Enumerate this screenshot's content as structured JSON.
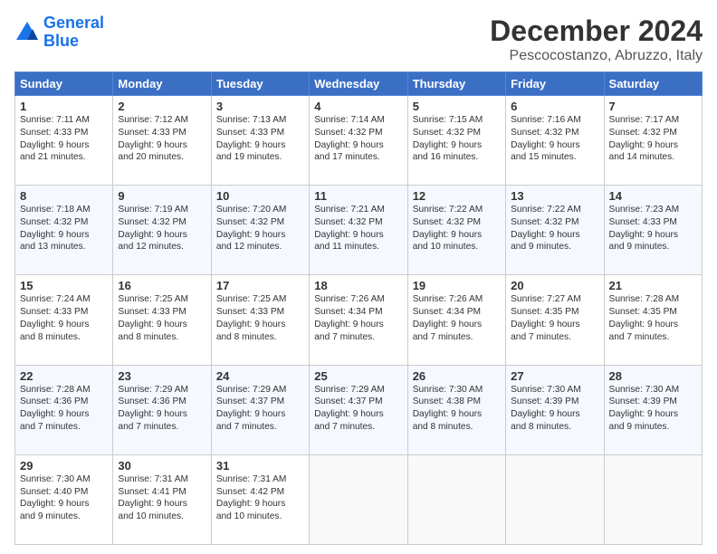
{
  "header": {
    "logo_line1": "General",
    "logo_line2": "Blue",
    "title": "December 2024",
    "subtitle": "Pescocostanzo, Abruzzo, Italy"
  },
  "columns": [
    "Sunday",
    "Monday",
    "Tuesday",
    "Wednesday",
    "Thursday",
    "Friday",
    "Saturday"
  ],
  "weeks": [
    [
      {
        "day": "1",
        "sunrise": "7:11 AM",
        "sunset": "4:33 PM",
        "daylight": "9 hours and 21 minutes."
      },
      {
        "day": "2",
        "sunrise": "7:12 AM",
        "sunset": "4:33 PM",
        "daylight": "9 hours and 20 minutes."
      },
      {
        "day": "3",
        "sunrise": "7:13 AM",
        "sunset": "4:33 PM",
        "daylight": "9 hours and 19 minutes."
      },
      {
        "day": "4",
        "sunrise": "7:14 AM",
        "sunset": "4:32 PM",
        "daylight": "9 hours and 17 minutes."
      },
      {
        "day": "5",
        "sunrise": "7:15 AM",
        "sunset": "4:32 PM",
        "daylight": "9 hours and 16 minutes."
      },
      {
        "day": "6",
        "sunrise": "7:16 AM",
        "sunset": "4:32 PM",
        "daylight": "9 hours and 15 minutes."
      },
      {
        "day": "7",
        "sunrise": "7:17 AM",
        "sunset": "4:32 PM",
        "daylight": "9 hours and 14 minutes."
      }
    ],
    [
      {
        "day": "8",
        "sunrise": "7:18 AM",
        "sunset": "4:32 PM",
        "daylight": "9 hours and 13 minutes."
      },
      {
        "day": "9",
        "sunrise": "7:19 AM",
        "sunset": "4:32 PM",
        "daylight": "9 hours and 12 minutes."
      },
      {
        "day": "10",
        "sunrise": "7:20 AM",
        "sunset": "4:32 PM",
        "daylight": "9 hours and 12 minutes."
      },
      {
        "day": "11",
        "sunrise": "7:21 AM",
        "sunset": "4:32 PM",
        "daylight": "9 hours and 11 minutes."
      },
      {
        "day": "12",
        "sunrise": "7:22 AM",
        "sunset": "4:32 PM",
        "daylight": "9 hours and 10 minutes."
      },
      {
        "day": "13",
        "sunrise": "7:22 AM",
        "sunset": "4:32 PM",
        "daylight": "9 hours and 9 minutes."
      },
      {
        "day": "14",
        "sunrise": "7:23 AM",
        "sunset": "4:33 PM",
        "daylight": "9 hours and 9 minutes."
      }
    ],
    [
      {
        "day": "15",
        "sunrise": "7:24 AM",
        "sunset": "4:33 PM",
        "daylight": "9 hours and 8 minutes."
      },
      {
        "day": "16",
        "sunrise": "7:25 AM",
        "sunset": "4:33 PM",
        "daylight": "9 hours and 8 minutes."
      },
      {
        "day": "17",
        "sunrise": "7:25 AM",
        "sunset": "4:33 PM",
        "daylight": "9 hours and 8 minutes."
      },
      {
        "day": "18",
        "sunrise": "7:26 AM",
        "sunset": "4:34 PM",
        "daylight": "9 hours and 7 minutes."
      },
      {
        "day": "19",
        "sunrise": "7:26 AM",
        "sunset": "4:34 PM",
        "daylight": "9 hours and 7 minutes."
      },
      {
        "day": "20",
        "sunrise": "7:27 AM",
        "sunset": "4:35 PM",
        "daylight": "9 hours and 7 minutes."
      },
      {
        "day": "21",
        "sunrise": "7:28 AM",
        "sunset": "4:35 PM",
        "daylight": "9 hours and 7 minutes."
      }
    ],
    [
      {
        "day": "22",
        "sunrise": "7:28 AM",
        "sunset": "4:36 PM",
        "daylight": "9 hours and 7 minutes."
      },
      {
        "day": "23",
        "sunrise": "7:29 AM",
        "sunset": "4:36 PM",
        "daylight": "9 hours and 7 minutes."
      },
      {
        "day": "24",
        "sunrise": "7:29 AM",
        "sunset": "4:37 PM",
        "daylight": "9 hours and 7 minutes."
      },
      {
        "day": "25",
        "sunrise": "7:29 AM",
        "sunset": "4:37 PM",
        "daylight": "9 hours and 7 minutes."
      },
      {
        "day": "26",
        "sunrise": "7:30 AM",
        "sunset": "4:38 PM",
        "daylight": "9 hours and 8 minutes."
      },
      {
        "day": "27",
        "sunrise": "7:30 AM",
        "sunset": "4:39 PM",
        "daylight": "9 hours and 8 minutes."
      },
      {
        "day": "28",
        "sunrise": "7:30 AM",
        "sunset": "4:39 PM",
        "daylight": "9 hours and 9 minutes."
      }
    ],
    [
      {
        "day": "29",
        "sunrise": "7:30 AM",
        "sunset": "4:40 PM",
        "daylight": "9 hours and 9 minutes."
      },
      {
        "day": "30",
        "sunrise": "7:31 AM",
        "sunset": "4:41 PM",
        "daylight": "9 hours and 10 minutes."
      },
      {
        "day": "31",
        "sunrise": "7:31 AM",
        "sunset": "4:42 PM",
        "daylight": "9 hours and 10 minutes."
      },
      null,
      null,
      null,
      null
    ]
  ]
}
